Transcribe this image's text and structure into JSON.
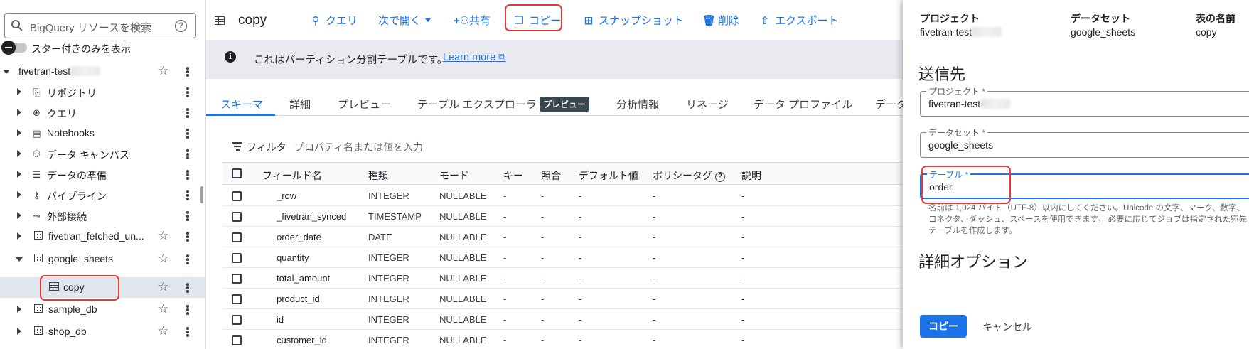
{
  "sidebar": {
    "search_placeholder": "BigQuery リソースを検索",
    "help_glyph": "?",
    "starred_only_label": "スター付きのみを表示",
    "project_label": "fivetran-test",
    "items": [
      {
        "label": "リポジトリ",
        "icon": "repository-icon"
      },
      {
        "label": "クエリ",
        "icon": "query-icon"
      },
      {
        "label": "Notebooks",
        "icon": "notebook-icon"
      },
      {
        "label": "データ キャンバス",
        "icon": "canvas-icon"
      },
      {
        "label": "データの準備",
        "icon": "data-prep-icon"
      },
      {
        "label": "パイプライン",
        "icon": "pipeline-icon"
      },
      {
        "label": "外部接続",
        "icon": "external-connection-icon"
      },
      {
        "label": "fivetran_fetched_un...",
        "icon": "dataset-icon"
      },
      {
        "label": "google_sheets",
        "icon": "dataset-icon"
      },
      {
        "label": "copy",
        "icon": "table-icon"
      },
      {
        "label": "sample_db",
        "icon": "dataset-icon"
      },
      {
        "label": "shop_db",
        "icon": "dataset-icon"
      }
    ]
  },
  "toolbar": {
    "title": "copy",
    "query": "クエリ",
    "open_with": "次で開く",
    "share": "共有",
    "copy": "コピー",
    "snapshot": "スナップショット",
    "delete": "削除",
    "export": "エクスポート"
  },
  "info": {
    "message": "これはパーティション分割テーブルです。",
    "learn_more": "Learn more"
  },
  "tabs": [
    "スキーマ",
    "詳細",
    "プレビュー",
    "テーブル エクスプローラ",
    "分析情報",
    "リネージ",
    "データ プロファイル",
    "データ"
  ],
  "tab_badge": "プレビュー",
  "filter": {
    "label": "フィルタ",
    "placeholder": "プロパティ名または値を入力"
  },
  "schema": {
    "headers": [
      "フィールド名",
      "種類",
      "モード",
      "キー",
      "照合",
      "デフォルト値",
      "ポリシータグ",
      "説明"
    ],
    "rows": [
      {
        "name": "_row",
        "type": "INTEGER",
        "mode": "NULLABLE",
        "key": "-",
        "collation": "-",
        "default": "-",
        "policy": "-",
        "desc": "-"
      },
      {
        "name": "_fivetran_synced",
        "type": "TIMESTAMP",
        "mode": "NULLABLE",
        "key": "-",
        "collation": "-",
        "default": "-",
        "policy": "-",
        "desc": "-"
      },
      {
        "name": "order_date",
        "type": "DATE",
        "mode": "NULLABLE",
        "key": "-",
        "collation": "-",
        "default": "-",
        "policy": "-",
        "desc": "-"
      },
      {
        "name": "quantity",
        "type": "INTEGER",
        "mode": "NULLABLE",
        "key": "-",
        "collation": "-",
        "default": "-",
        "policy": "-",
        "desc": "-"
      },
      {
        "name": "total_amount",
        "type": "INTEGER",
        "mode": "NULLABLE",
        "key": "-",
        "collation": "-",
        "default": "-",
        "policy": "-",
        "desc": "-"
      },
      {
        "name": "product_id",
        "type": "INTEGER",
        "mode": "NULLABLE",
        "key": "-",
        "collation": "-",
        "default": "-",
        "policy": "-",
        "desc": "-"
      },
      {
        "name": "id",
        "type": "INTEGER",
        "mode": "NULLABLE",
        "key": "-",
        "collation": "-",
        "default": "-",
        "policy": "-",
        "desc": "-"
      },
      {
        "name": "customer_id",
        "type": "INTEGER",
        "mode": "NULLABLE",
        "key": "-",
        "collation": "-",
        "default": "-",
        "policy": "-",
        "desc": "-"
      }
    ]
  },
  "panel": {
    "source": {
      "project_header": "プロジェクト",
      "project_value": "fivetran-test",
      "dataset_header": "データセット",
      "dataset_value": "google_sheets",
      "table_header": "表の名前",
      "table_value": "copy"
    },
    "destination_title": "送信先",
    "project_field": {
      "label": "プロジェクト *",
      "value": "fivetran-test"
    },
    "dataset_field": {
      "label": "データセット *",
      "value": "google_sheets"
    },
    "table_field": {
      "label": "テーブル *",
      "value": "order"
    },
    "hint": "名前は 1,024 バイト（UTF-8）以内にしてください。Unicode の文字、マーク、数字、コネクタ、ダッシュ、スペースを使用できます。 必要に応じてジョブは指定された宛先テーブルを作成します。",
    "advanced_title": "詳細オプション",
    "copy_button": "コピー",
    "cancel_button": "キャンセル"
  },
  "colors": {
    "accent": "#1a73e8",
    "highlight_box": "#e53935",
    "selected_row": "#e1e5ee",
    "info_bar": "#e8eaf0"
  }
}
